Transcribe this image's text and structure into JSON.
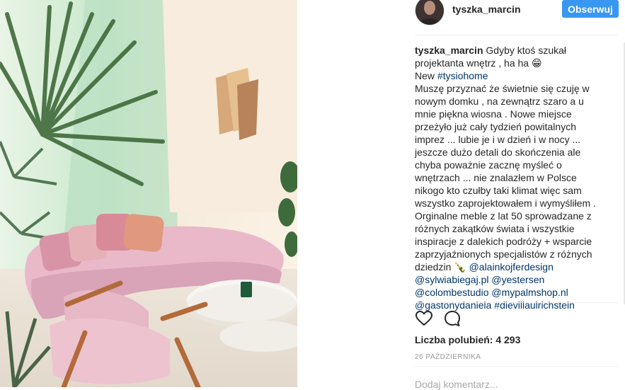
{
  "post": {
    "username": "tyszka_marcin",
    "follow_label": "Obserwuj",
    "caption": {
      "username": "tyszka_marcin",
      "line1": "Gdyby ktoś szukał projektanta wnętrz , ha ha 😁",
      "new_prefix": "New ",
      "hashtag_new": "#tysiohome",
      "body": "Muszę przyznać że świetnie się czuję w nowym domku , na zewnątrz szaro a u mnie piękna wiosna . Nowe miejsce przeżyło już cały tydzień powitalnych imprez ... lubie je i w dzień i w nocy ... jeszcze dużo detali do skończenia ale chyba poważnie zacznę myśleć o wnętrzach ... nie znalazłem w Polsce nikogo kto czułby taki klimat więc sam wszystko zaprojektowałem i wymyśliłem . Orginalne meble z lat 50 sprowadzane z różnych zakątków świata i wszystkie inspiracje z dalekich podróży + wsparcie zaprzyjaźnionych specjalistów z różnych dziedzin 🍾 ",
      "mention1": "@alainkojferdesign",
      "mention2": "@sylwiabiegaj.pl",
      "mention3": "@yestersen",
      "mention4": "@colombestudio",
      "mention5": "@mypalmshop.nl",
      "mention6": "@gastonydaniela",
      "hashtag_end": "#dievillaulrichstein"
    },
    "likes_text": "Liczba polubień: 4 293",
    "date": "26 PAŹDZIERNIKA",
    "comment_placeholder": "Dodaj komentarz..."
  },
  "icons": {
    "like": "heart-icon",
    "comment": "comment-icon"
  },
  "colors": {
    "follow_button": "#3897f0",
    "link": "#003569",
    "wall_mint": "#bfe3c6",
    "sofa_pink": "#e8b8c8"
  }
}
